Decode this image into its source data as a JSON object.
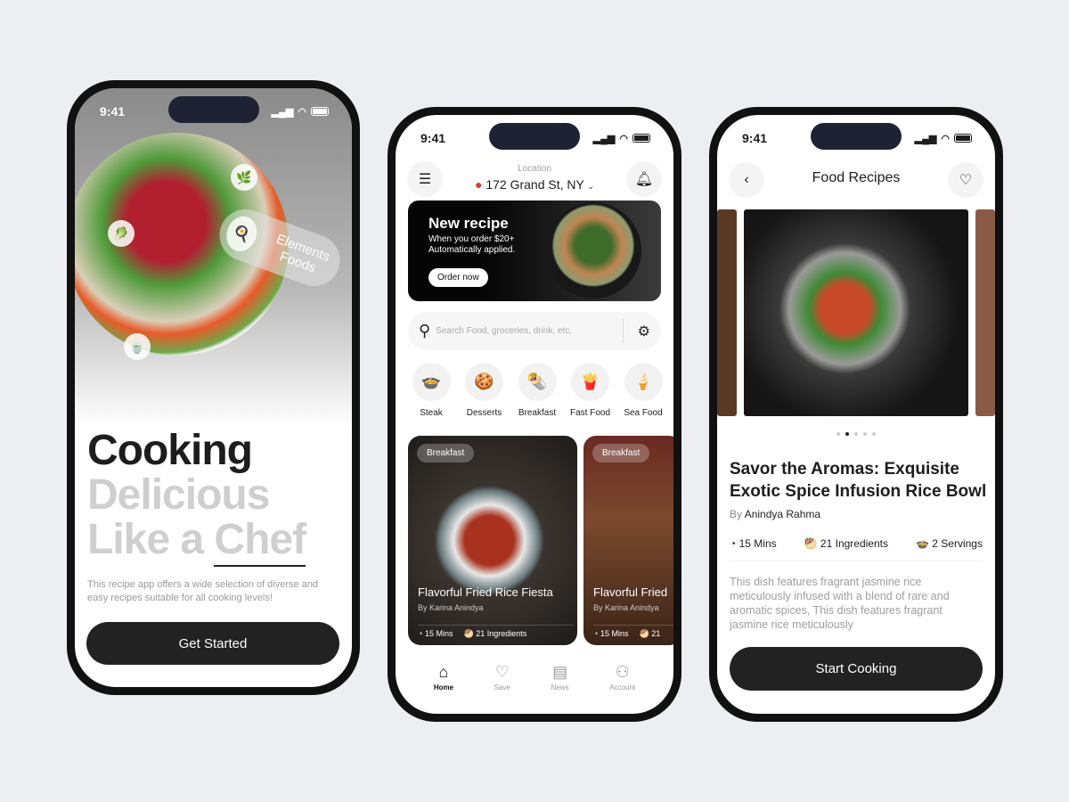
{
  "status": {
    "time": "9:41"
  },
  "onboarding": {
    "badge": "Elements Foods",
    "title_line1": "Cooking",
    "title_line2": "Delicious",
    "title_line3a": "Like a ",
    "title_line3b": "Chef",
    "description": "This recipe app offers a wide selection of diverse and easy recipes suitable for all cooking levels!",
    "cta": "Get Started"
  },
  "home": {
    "location_label": "Location",
    "location_value": "172 Grand St, NY",
    "banner": {
      "title": "New recipe",
      "line1": "When you order $20+",
      "line2": "Automatically applied.",
      "button": "Order now"
    },
    "search_placeholder": "Search Food, groceries, drink, etc.",
    "categories": [
      {
        "label": "Steak",
        "icon": "🍲"
      },
      {
        "label": "Desserts",
        "icon": "🍪"
      },
      {
        "label": "Breakfast",
        "icon": "🌯"
      },
      {
        "label": "Fast Food",
        "icon": "🍟"
      },
      {
        "label": "Sea Food",
        "icon": "🍦"
      }
    ],
    "cards": [
      {
        "tag": "Breakfast",
        "name": "Flavorful Fried Rice Fiesta",
        "author": "By Karina Anindya",
        "time": "15 Mins",
        "ingredients": "21 Ingredients"
      },
      {
        "tag": "Breakfast",
        "name": "Flavorful Fried",
        "author": "By Karina Anindya",
        "time": "15 Mins",
        "ingredients": "21"
      }
    ],
    "nav": [
      {
        "label": "Home",
        "icon": "home-icon"
      },
      {
        "label": "Save",
        "icon": "heart-icon"
      },
      {
        "label": "News",
        "icon": "news-icon"
      },
      {
        "label": "Account",
        "icon": "user-icon"
      }
    ]
  },
  "detail": {
    "header": "Food Recipes",
    "title": "Savor the Aromas: Exquisite Exotic Spice Infusion Rice Bowl",
    "by": "By",
    "author": "Anindya Rahma",
    "time": "15 Mins",
    "ingredients": "21 Ingredients",
    "servings": "2 Servings",
    "description": "This dish features fragrant jasmine rice meticulously infused with a blend of rare and aromatic spices, This dish features fragrant jasmine rice meticulously",
    "cta": "Start Cooking",
    "carousel_active": 2,
    "carousel_count": 5
  }
}
